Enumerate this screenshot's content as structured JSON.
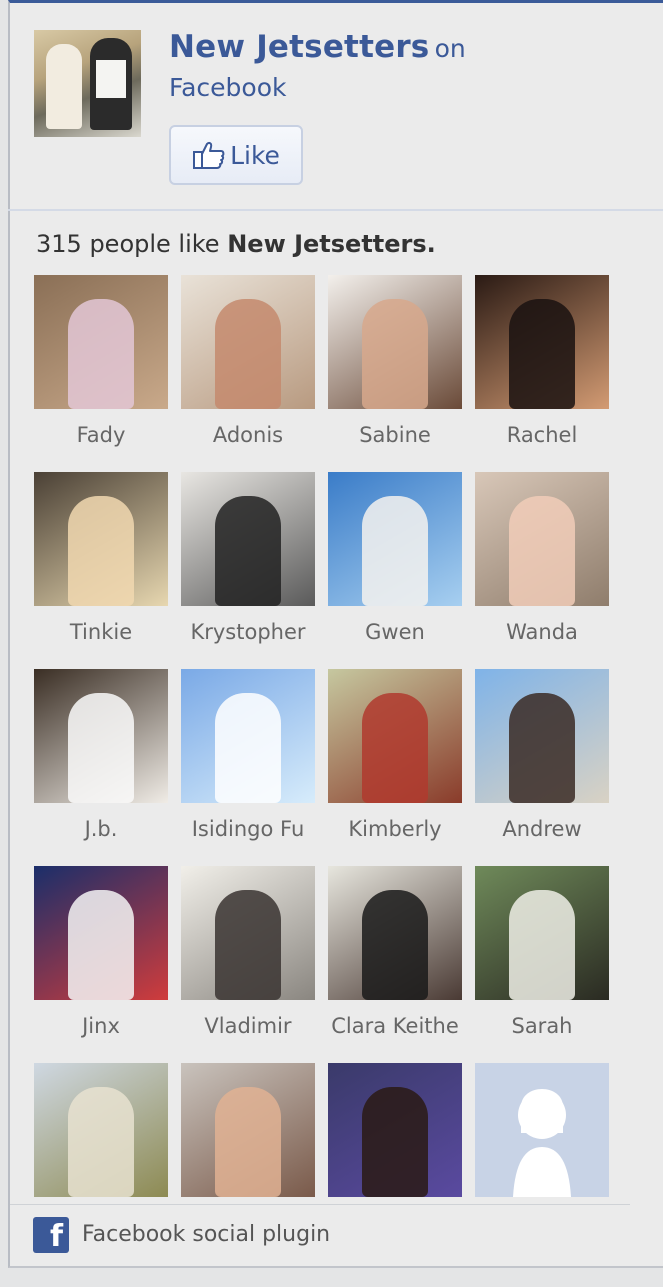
{
  "header": {
    "page_name": "New Jetsetters",
    "on_text": "on",
    "facebook_text": "Facebook",
    "like_label": "Like"
  },
  "likes": {
    "count_text": "315 people like",
    "page_name": "New Jetsetters."
  },
  "friends": [
    {
      "name": "Fady",
      "bg": [
        "#8a6f56",
        "#c9a98a"
      ],
      "fg": "#e3c7d6"
    },
    {
      "name": "Adonis",
      "bg": [
        "#e9e2d8",
        "#b89a80"
      ],
      "fg": "#c48a6d"
    },
    {
      "name": "Sabine",
      "bg": [
        "#f3f0ec",
        "#6a4a38"
      ],
      "fg": "#d7a88c"
    },
    {
      "name": "Rachel",
      "bg": [
        "#2a1a14",
        "#d39b73"
      ],
      "fg": "#1a1210"
    },
    {
      "name": "Tinkie",
      "bg": [
        "#4a4035",
        "#e7d7b0"
      ],
      "fg": "#f1d8b0"
    },
    {
      "name": "Krystopher",
      "bg": [
        "#e8e6e2",
        "#5a5a5a"
      ],
      "fg": "#222222"
    },
    {
      "name": "Gwen",
      "bg": [
        "#3a7cc8",
        "#a7cff0"
      ],
      "fg": "#f4f2ee"
    },
    {
      "name": "Wanda",
      "bg": [
        "#d8c7b8",
        "#8f7d6c"
      ],
      "fg": "#f1cdb8"
    },
    {
      "name": "J.b.",
      "bg": [
        "#3a2e24",
        "#f0ece6"
      ],
      "fg": "#fafafa"
    },
    {
      "name": "Isidingo Fu",
      "bg": [
        "#7aa9e6",
        "#d7ecfb"
      ],
      "fg": "#ffffff"
    },
    {
      "name": "Kimberly",
      "bg": [
        "#c6c8a0",
        "#8a3b2a"
      ],
      "fg": "#b03a2e"
    },
    {
      "name": "Andrew",
      "bg": [
        "#7fb3e8",
        "#d9d2c4"
      ],
      "fg": "#3a2a24"
    },
    {
      "name": "Jinx",
      "bg": [
        "#1a2e6a",
        "#d03c3c"
      ],
      "fg": "#f4f4f4"
    },
    {
      "name": "Vladimir",
      "bg": [
        "#f1efe9",
        "#8a8680"
      ],
      "fg": "#3a3431"
    },
    {
      "name": "Clara Keithe",
      "bg": [
        "#e7e6de",
        "#4a3a34"
      ],
      "fg": "#1a1a1a"
    },
    {
      "name": "Sarah",
      "bg": [
        "#6f8a5a",
        "#2a2a22"
      ],
      "fg": "#efefe6"
    },
    {
      "name": "",
      "bg": [
        "#cfd8e2",
        "#8d8a52"
      ],
      "fg": "#e8e2d0"
    },
    {
      "name": "",
      "bg": [
        "#c9c3bd",
        "#7a5a4a"
      ],
      "fg": "#e0b293"
    },
    {
      "name": "",
      "bg": [
        "#3a3a6a",
        "#5a4aa0"
      ],
      "fg": "#2a1a14"
    },
    {
      "name": "",
      "bg": [
        "#c8d3e6",
        "#c8d3e6"
      ],
      "fg": "#ffffff",
      "placeholder": true
    }
  ],
  "footer": {
    "logo_glyph": "f",
    "text": "Facebook social plugin"
  },
  "colors": {
    "brand": "#3b5998",
    "background": "#ebebeb",
    "name_text": "#666666"
  }
}
